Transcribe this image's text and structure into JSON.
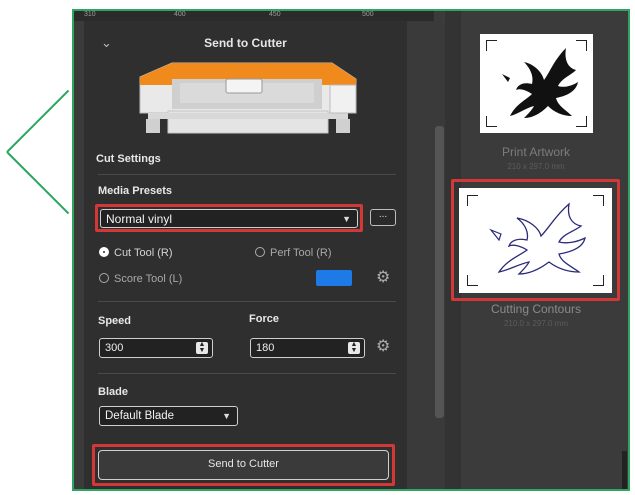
{
  "ruler": {
    "ticks": [
      "310",
      "400",
      "450",
      "500"
    ]
  },
  "panel": {
    "title": "Send to Cutter",
    "collapse_icon": "chevron-down-icon",
    "cut_settings_label": "Cut Settings",
    "media_presets_label": "Media Presets",
    "media_preset_value": "Normal vinyl",
    "more_button_label": "...",
    "tools": {
      "cut": "Cut Tool (R)",
      "perf": "Perf Tool (R)",
      "score": "Score Tool (L)"
    },
    "score_color": "#1e7ae6",
    "speed_label": "Speed",
    "speed_value": "300",
    "force_label": "Force",
    "force_value": "180",
    "blade_label": "Blade",
    "blade_value": "Default Blade",
    "send_button_label": "Send to Cutter"
  },
  "thumbnails": [
    {
      "title": "Print Artwork",
      "size": "210 x 297.0 mm"
    },
    {
      "title": "Cutting Contours",
      "size": "210.0 x 297.0 mm"
    }
  ],
  "colors": {
    "highlight": "#d33838",
    "callout": "#2fa562",
    "accent": "#f18a1d"
  }
}
